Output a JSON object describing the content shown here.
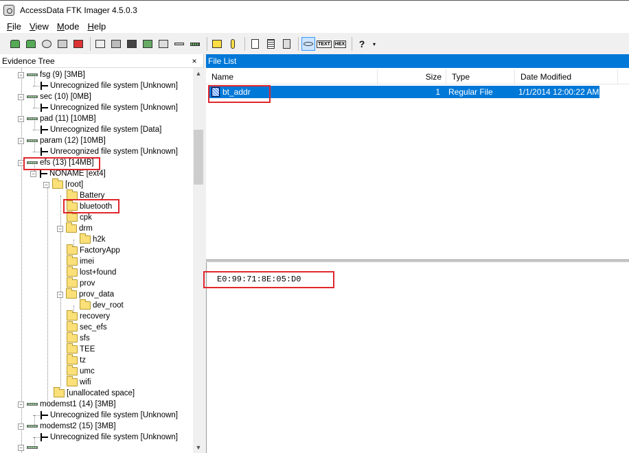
{
  "window": {
    "title": "AccessData FTK Imager 4.5.0.3"
  },
  "menu": [
    {
      "u": "F",
      "rest": "ile"
    },
    {
      "u": "V",
      "rest": "iew"
    },
    {
      "u": "M",
      "rest": "ode"
    },
    {
      "u": "H",
      "rest": "elp"
    }
  ],
  "toolbar": {
    "text_label": "TEXT",
    "hex_label": "HEX",
    "help_glyph": "?"
  },
  "evidence_tree": {
    "title": "Evidence Tree",
    "close_glyph": "×",
    "items": [
      {
        "label": "fsg (9) [3MB]"
      },
      {
        "label": "Unrecognized file system [Unknown]"
      },
      {
        "label": "sec (10) [0MB]"
      },
      {
        "label": "Unrecognized file system [Unknown]"
      },
      {
        "label": "pad (11) [10MB]"
      },
      {
        "label": "Unrecognized file system [Data]"
      },
      {
        "label": "param (12) [10MB]"
      },
      {
        "label": "Unrecognized file system [Unknown]"
      },
      {
        "label": "efs (13) [14MB]"
      },
      {
        "label": "NONAME [ext4]"
      },
      {
        "label": "[root]"
      },
      {
        "label": "Battery"
      },
      {
        "label": "bluetooth"
      },
      {
        "label": "cpk"
      },
      {
        "label": "drm"
      },
      {
        "label": "h2k"
      },
      {
        "label": "FactoryApp"
      },
      {
        "label": "imei"
      },
      {
        "label": "lost+found"
      },
      {
        "label": "prov"
      },
      {
        "label": "prov_data"
      },
      {
        "label": "dev_root"
      },
      {
        "label": "recovery"
      },
      {
        "label": "sec_efs"
      },
      {
        "label": "sfs"
      },
      {
        "label": "TEE"
      },
      {
        "label": "tz"
      },
      {
        "label": "umc"
      },
      {
        "label": "wifi"
      },
      {
        "label": "[unallocated space]"
      },
      {
        "label": "modemst1 (14) [3MB]"
      },
      {
        "label": "Unrecognized file system [Unknown]"
      },
      {
        "label": "modemst2 (15) [3MB]"
      },
      {
        "label": "Unrecognized file system [Unknown]"
      }
    ]
  },
  "file_list": {
    "title": "File List",
    "columns": [
      "Name",
      "Size",
      "Type",
      "Date Modified"
    ],
    "rows": [
      {
        "name": "bt_addr",
        "size": "1",
        "type": "Regular File",
        "date": "1/1/2014 12:00:22 AM"
      }
    ]
  },
  "content_view": {
    "text": "E0:99:71:8E:05:D0"
  },
  "colors": {
    "selection": "#0078d7",
    "highlight_box": "#e0262c",
    "folder": "#fbe07a"
  }
}
